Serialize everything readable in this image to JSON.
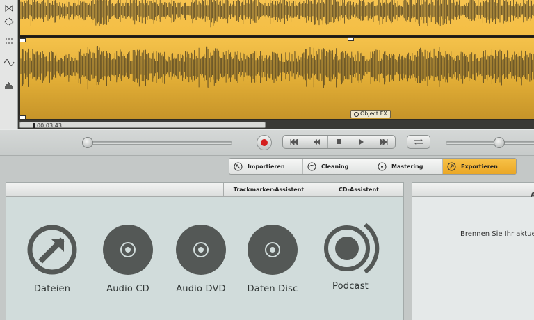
{
  "editor": {
    "time_readout": "00:03:43",
    "object_fx_label": "Object FX",
    "tools": [
      "trim-icon",
      "marquee-icon",
      "envelope-icon",
      "spectrum-icon",
      "waveform-tool-icon"
    ]
  },
  "colors": {
    "wave_fill": "#f7c14a",
    "wave_fill_dark": "#c8992d",
    "wave_stroke": "#3d3420",
    "active_tab": "#f2b437",
    "record_red": "#d41e1e"
  },
  "transport": {
    "buttons": [
      "skip-to-start-icon",
      "rewind-icon",
      "stop-icon",
      "play-icon",
      "skip-to-end-icon"
    ]
  },
  "tabs": [
    {
      "label": "Importieren",
      "icon": "import-icon"
    },
    {
      "label": "Cleaning",
      "icon": "cleaning-icon"
    },
    {
      "label": "Mastering",
      "icon": "mastering-icon"
    },
    {
      "label": "Exportieren",
      "icon": "export-icon",
      "active": true
    }
  ],
  "panel": {
    "header_assistants": [
      "Trackmarker-Assistent",
      "CD-Assistent"
    ],
    "items": [
      {
        "label": "Dateien",
        "icon": "files-export-icon"
      },
      {
        "label": "Audio CD",
        "icon": "audio-cd-icon"
      },
      {
        "label": "Audio DVD",
        "icon": "audio-dvd-icon"
      },
      {
        "label": "Daten Disc",
        "icon": "data-disc-icon"
      },
      {
        "label": "Podcast",
        "icon": "podcast-icon"
      }
    ]
  },
  "right_panel": {
    "header_letter": "A",
    "text": "Brennen Sie Ihr aktue"
  }
}
